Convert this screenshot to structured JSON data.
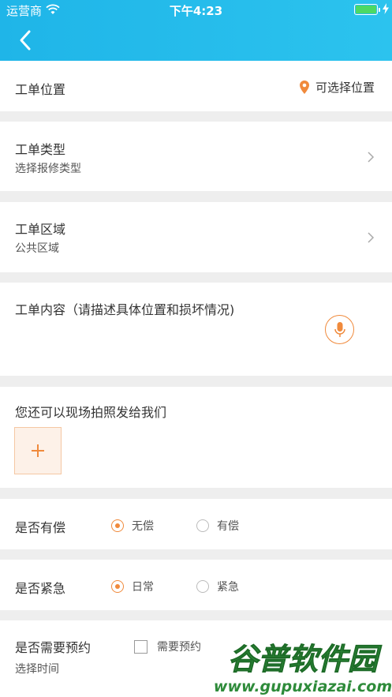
{
  "status_bar": {
    "carrier": "运营商",
    "time": "下午4:23"
  },
  "location": {
    "label": "工单位置",
    "action": "可选择位置"
  },
  "type": {
    "label": "工单类型",
    "value": "选择报修类型"
  },
  "area": {
    "label": "工单区域",
    "value": "公共区域"
  },
  "content": {
    "label": "工单内容（请描述具体位置和损坏情况)"
  },
  "photo": {
    "label": "您还可以现场拍照发给我们"
  },
  "paid": {
    "label": "是否有偿",
    "options": [
      "无偿",
      "有偿"
    ],
    "selected": "无偿"
  },
  "urgent": {
    "label": "是否紧急",
    "options": [
      "日常",
      "紧急"
    ],
    "selected": "日常"
  },
  "appointment": {
    "label": "是否需要预约",
    "checkbox_label": "需要预约",
    "checked": false,
    "time_label": "选择时间"
  },
  "watermark": {
    "title": "谷普软件园",
    "url": "www.gupuxiazai.com"
  },
  "colors": {
    "header": "#1fb5e8",
    "accent": "#f08a3c",
    "watermark": "#2e8b3a"
  }
}
